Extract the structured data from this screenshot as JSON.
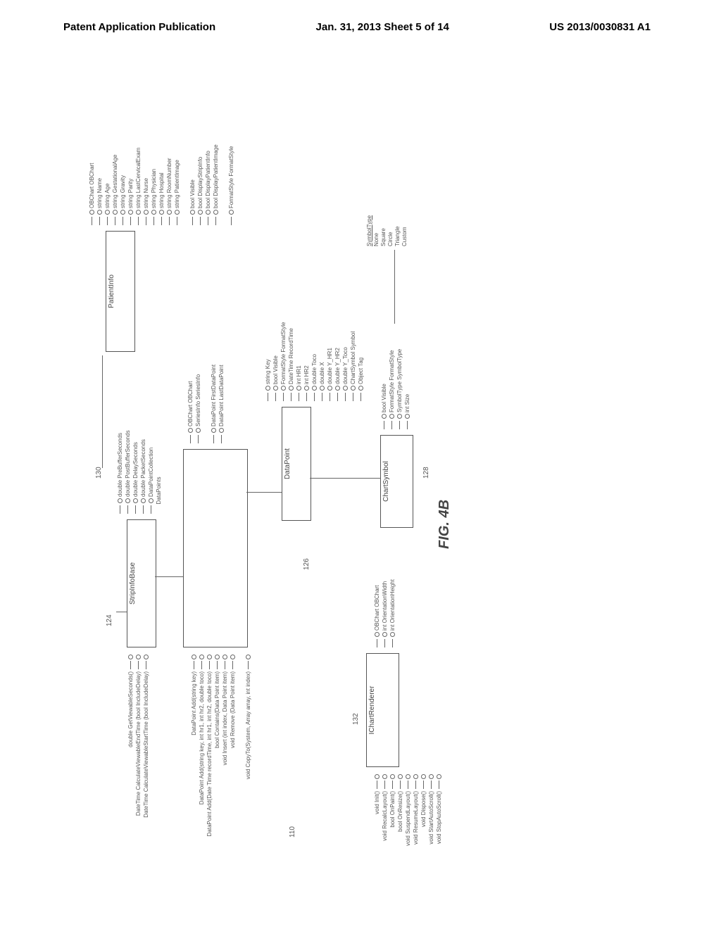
{
  "header": {
    "left": "Patent Application Publication",
    "center": "Jan. 31, 2013  Sheet 5 of 14",
    "right": "US 2013/0030831 A1"
  },
  "figure_label": "FIG. 4B",
  "refs": {
    "r110": "110",
    "r124": "124",
    "r126": "126",
    "r128": "128",
    "r130": "130",
    "r132": "132"
  },
  "classes": {
    "stripinfobase": {
      "name": "StripInfoBase",
      "props": [
        "double PreBufferSeconds",
        "double PostBufferSeconds",
        "double DelaySeconds",
        "double PacketSeconds",
        "DataPointCollection",
        "DataPoints"
      ],
      "methods": [
        "double GetViewableSeconds()",
        "DateTime CalculateViewableEndTime (bool IncludeDelay)",
        "DateTime CalculateViewableStartTime (bool IncludeDelay)"
      ]
    },
    "patientinfo": {
      "name": "PatientInfo",
      "props": [
        "OBChart OBChart",
        "string Name",
        "string Age",
        "string GestationalAge",
        "string Gravity",
        "string Parity",
        "string LastCervicalExam",
        "string Nurse",
        "string Physician",
        "string Hospital",
        "string RoomNumber",
        "string PatientImage",
        "",
        "bool Visible",
        "bool DisplayStripInfo",
        "bool DisplayPatientInfo",
        "bool DisplayPatientImage",
        "",
        "FormatStyle FormatStyle"
      ]
    },
    "datapointcoll": {
      "name": "",
      "subprops": [
        "OBChart OBChart",
        "SeriesInfo SeriesInfo",
        "",
        "DataPoint FirstDataPoint",
        "DataPoint LastDataPoint"
      ],
      "methods": [
        "DataPoint Add(string key)",
        "DataPoint Add(string key, int hr1, int hr2, double toco)",
        "DataPoint Add(Date Time recordTime, int hr1, int hr2, double toco)",
        "bool Contains(Data Point item)",
        "void Insert (int index, Data Point item)",
        "void Remove (Data Point item)",
        "",
        "void CopyTo(System, Array array, int index)"
      ]
    },
    "datapoint": {
      "name": "DataPoint",
      "props": [
        "string Key",
        "bool Visible",
        "FormatStyle FormatStyle",
        "DateTime RecordTime",
        "int HR1",
        "int HR2",
        "double Toco",
        "double X",
        "double Y_HR1",
        "double Y_HR2",
        "double Y_Toco",
        "ChartSymbol Symbol",
        "Object Tag"
      ]
    },
    "chartsymbol": {
      "name": "ChartSymbol",
      "props": [
        "bool Visible",
        "FormatStyle FormatStyle",
        "SymbolType SymbolType",
        "int Size"
      ]
    },
    "ichartrenderer": {
      "name": "IChartRenderer",
      "props": [
        "OBChart OBChart",
        "int OrientationWidth",
        "int OrientationHeight"
      ],
      "methods": [
        "void Init()",
        "void RecalcLayout()",
        "bool OnPaint()",
        "bool OnResize()",
        "void SuspendLayout()",
        "void ResumeLayout()",
        "void Dispose()",
        "void StartAutoScroll()",
        "void StopAutoScroll()"
      ]
    },
    "symboltype": {
      "title": "SymbolType",
      "values": [
        "None",
        "Square",
        "Circle",
        "Triangle",
        "Custom"
      ]
    }
  }
}
